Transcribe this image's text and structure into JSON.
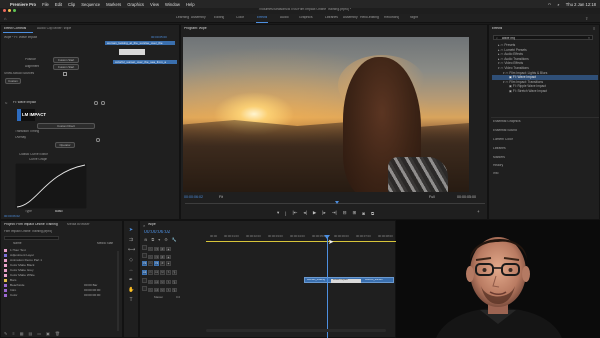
{
  "menubar": {
    "app_name": "Premiere Pro",
    "items": [
      "File",
      "Edit",
      "Clip",
      "Sequence",
      "Markers",
      "Graphics",
      "View",
      "Window",
      "Help"
    ],
    "clock": "Thu 2 Jan 12:18"
  },
  "titlebar": {
    "path": "/Volumes/Seasons/BTNS/Film Impact Online Training.prproj *"
  },
  "workspaces": {
    "tabs": [
      "Learning",
      "Assembly",
      "Editing",
      "Color",
      "Effects",
      "Audio",
      "Graphics",
      "Libraries",
      "Assembly",
      "Hello-editing",
      "Recording",
      "Night"
    ],
    "active_index": 4
  },
  "effect_controls": {
    "tabs": [
      "Effect Controls",
      "Audio Clip Mixer: Wipe",
      "Lumetri Scopes"
    ],
    "source_label": "Wipe * FI: Wave Impact",
    "timecode_start": "00:00:05:00",
    "clip_a": "woman_looking_at_the_sunrise_over_the",
    "clip_b": "colorful_sunset_over_the_sea_from_a",
    "position_label": "Position",
    "position_value": "Custom Start",
    "alignment_label": "Alignment",
    "alignment_value": "Custom Start",
    "show_actual_sources": "Show Actual Sources",
    "checkbox_label": "Custom",
    "effect_name": "FI: Wave Impact",
    "logo_text": "LM IMPACT",
    "custom_button": "Custom Direct",
    "transition_timing": "Transition Timing",
    "overlay_label": "Overlay",
    "operator_button": "Operator",
    "classic_curve": "Classic Curve Editor",
    "curve_graph": "Curve Graph",
    "type_label": "Type",
    "type_value": "Basic",
    "footer_timecode": "00:00:06:02"
  },
  "program": {
    "tab": "Program: Wipe",
    "timecode": "00:00:06:02",
    "fit": "Fit",
    "quality": "Full",
    "duration": "00:00:05:00"
  },
  "effects": {
    "tab": "Effects",
    "search_value": "wave imp",
    "tree": [
      {
        "label": "Presets",
        "sel": false,
        "indent": 1
      },
      {
        "label": "Lumetri Presets",
        "sel": false,
        "indent": 1
      },
      {
        "label": "Audio Effects",
        "sel": false,
        "indent": 1
      },
      {
        "label": "Audio Transitions",
        "sel": false,
        "indent": 1
      },
      {
        "label": "Video Effects",
        "sel": false,
        "indent": 1
      },
      {
        "label": "Video Transitions",
        "sel": false,
        "indent": 1
      },
      {
        "label": "Film Impact: Lights & Blurs",
        "sel": false,
        "indent": 2
      },
      {
        "label": "FI: Wave Impact",
        "sel": true,
        "indent": 3
      },
      {
        "label": "Film Impact: Transitions",
        "sel": false,
        "indent": 2
      },
      {
        "label": "FI: Ripple Wave Impact",
        "sel": false,
        "indent": 3
      },
      {
        "label": "FI: Stretch Wave Impact",
        "sel": false,
        "indent": 3
      }
    ],
    "sections": [
      "Essential Graphics",
      "Essential Sound",
      "Lumetri Color",
      "Libraries",
      "Markers",
      "History",
      "Info"
    ]
  },
  "project": {
    "tabs": [
      "Project: Film Impact Online Training",
      "Media Browser"
    ],
    "project_file": "Film Impact Online Training.prproj",
    "header_name": "Name",
    "header_fps": "Media Start",
    "items": [
      {
        "name": "1 Hour Text",
        "fps": "",
        "color": "#e7a1c9"
      },
      {
        "name": "Adjustment Layer",
        "fps": "",
        "color": "#7c6fd6"
      },
      {
        "name": "Animation Demo Part 1",
        "fps": "",
        "color": "#e7a1c9"
      },
      {
        "name": "Color Matte Black",
        "fps": "",
        "color": "#e7a1c9"
      },
      {
        "name": "Color Matte Grey",
        "fps": "",
        "color": "#e7a1c9"
      },
      {
        "name": "Color Matte White",
        "fps": "",
        "color": "#e7a1c9"
      },
      {
        "name": "Bars",
        "fps": "",
        "color": "#e3c04a"
      },
      {
        "name": "Beachside",
        "fps": "00:00 Bar",
        "color": "#9b68d1"
      },
      {
        "name": "Intro",
        "fps": "00:00:00:00",
        "color": "#9b68d1"
      },
      {
        "name": "Color",
        "fps": "00:00:00:00",
        "color": "#9b68d1"
      }
    ]
  },
  "timeline": {
    "tab": "Wipe",
    "timecode": "00:00:06:02",
    "ruler": [
      "00:00",
      "00:00:01:00",
      "00:00:02:00",
      "00:00:03:00",
      "00:00:04:00",
      "00:00:05:00",
      "00:00:06:00",
      "00:00:07:00",
      "00:00:08:00"
    ],
    "tracks": [
      "V3",
      "V2",
      "V1",
      "A1",
      "A2",
      "A3",
      "Master"
    ],
    "master_value": "0.0",
    "clip_a": "woman_looking",
    "clip_transition": "Wave Impact",
    "clip_b": "colorful_sunset"
  },
  "colors": {
    "accent": "#4d8fe0",
    "selection": "#2f4f77",
    "clip_blue": "#3a6fae",
    "playhead": "#4d8fe0"
  }
}
